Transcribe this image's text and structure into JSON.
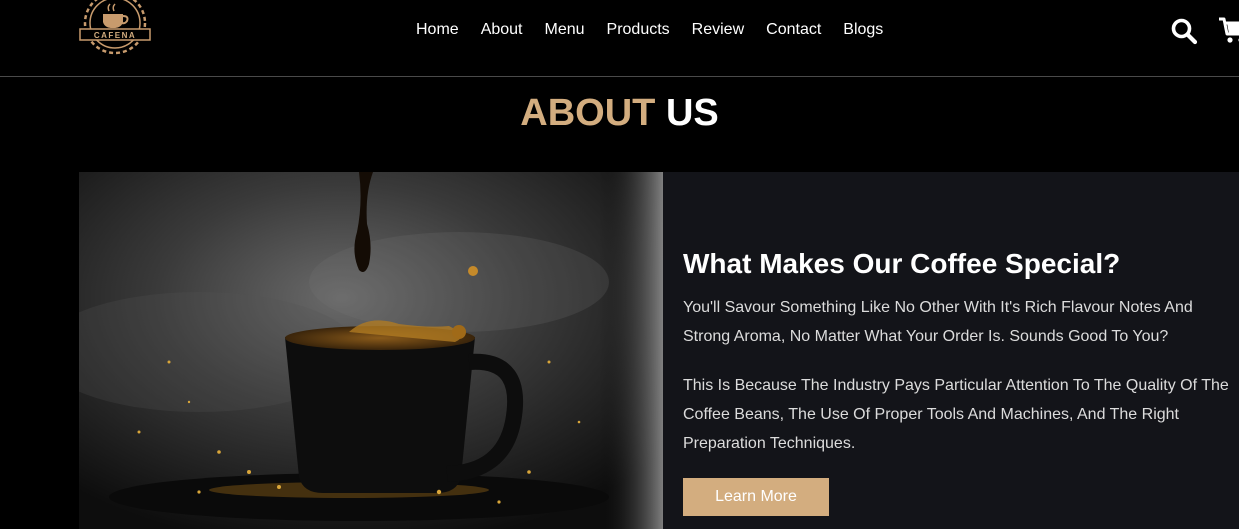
{
  "header": {
    "logo_text": "CAFENA",
    "nav": [
      {
        "label": "Home"
      },
      {
        "label": "About"
      },
      {
        "label": "Menu"
      },
      {
        "label": "Products"
      },
      {
        "label": "Review"
      },
      {
        "label": "Contact"
      },
      {
        "label": "Blogs"
      }
    ],
    "icons": [
      "search-icon",
      "cart-icon"
    ]
  },
  "section": {
    "heading_accent": "ABOUT",
    "heading_plain": "US"
  },
  "about": {
    "title": "What Makes Our Coffee Special?",
    "paragraph1": "You'll Savour Something Like No Other With It's Rich Flavour Notes And Strong Aroma, No Matter What Your Order Is. Sounds Good To You?",
    "paragraph2": "This Is Because The Industry Pays Particular Attention To The Quality Of The Coffee Beans, The Use Of Proper Tools And Machines, And The Right Preparation Techniques.",
    "button_label": "Learn More"
  },
  "colors": {
    "accent": "#d3ad7f",
    "background": "#000000",
    "panel": "#131419",
    "text": "#ffffff"
  }
}
